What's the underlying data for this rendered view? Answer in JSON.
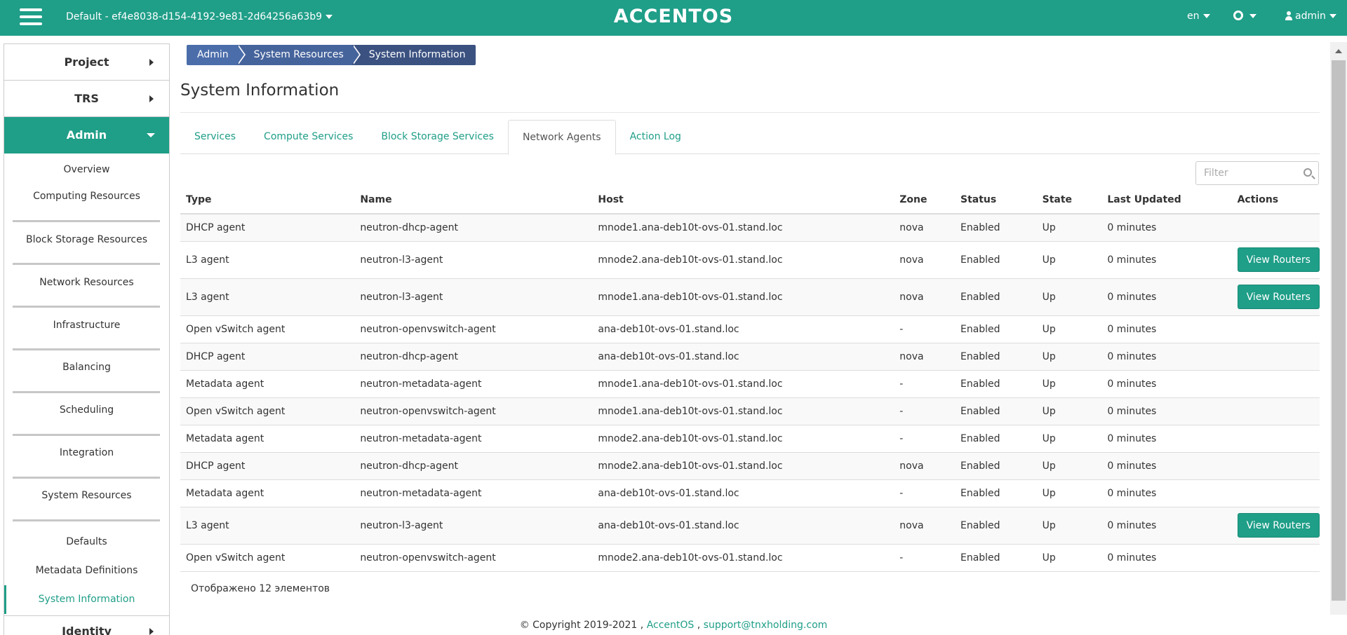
{
  "topbar": {
    "project": "Default - ef4e8038-d154-4192-9e81-2d64256a63b9",
    "logo": "ACCENTOS",
    "language": "en",
    "user": "admin"
  },
  "sidebar": {
    "project": "Project",
    "trs": "TRS",
    "admin": "Admin",
    "items": [
      "Overview",
      "Computing Resources",
      "Block Storage Resources",
      "Network Resources",
      "Infrastructure",
      "Balancing",
      "Scheduling",
      "Integration",
      "System Resources"
    ],
    "sub_items": [
      "Defaults",
      "Metadata Definitions",
      "System Information"
    ],
    "identity": "Identity"
  },
  "breadcrumb": [
    "Admin",
    "System Resources",
    "System Information"
  ],
  "page_title": "System Information",
  "tabs": [
    "Services",
    "Compute Services",
    "Block Storage Services",
    "Network Agents",
    "Action Log"
  ],
  "filter": {
    "placeholder": "Filter"
  },
  "table": {
    "headers": [
      "Type",
      "Name",
      "Host",
      "Zone",
      "Status",
      "State",
      "Last Updated",
      "Actions"
    ],
    "action_label": "View Routers",
    "rows": [
      {
        "type": "DHCP agent",
        "name": "neutron-dhcp-agent",
        "host": "mnode1.ana-deb10t-ovs-01.stand.loc",
        "zone": "nova",
        "status": "Enabled",
        "state": "Up",
        "updated": "0 minutes",
        "action": false
      },
      {
        "type": "L3 agent",
        "name": "neutron-l3-agent",
        "host": "mnode2.ana-deb10t-ovs-01.stand.loc",
        "zone": "nova",
        "status": "Enabled",
        "state": "Up",
        "updated": "0 minutes",
        "action": true
      },
      {
        "type": "L3 agent",
        "name": "neutron-l3-agent",
        "host": "mnode1.ana-deb10t-ovs-01.stand.loc",
        "zone": "nova",
        "status": "Enabled",
        "state": "Up",
        "updated": "0 minutes",
        "action": true
      },
      {
        "type": "Open vSwitch agent",
        "name": "neutron-openvswitch-agent",
        "host": "ana-deb10t-ovs-01.stand.loc",
        "zone": "-",
        "status": "Enabled",
        "state": "Up",
        "updated": "0 minutes",
        "action": false
      },
      {
        "type": "DHCP agent",
        "name": "neutron-dhcp-agent",
        "host": "ana-deb10t-ovs-01.stand.loc",
        "zone": "nova",
        "status": "Enabled",
        "state": "Up",
        "updated": "0 minutes",
        "action": false
      },
      {
        "type": "Metadata agent",
        "name": "neutron-metadata-agent",
        "host": "mnode1.ana-deb10t-ovs-01.stand.loc",
        "zone": "-",
        "status": "Enabled",
        "state": "Up",
        "updated": "0 minutes",
        "action": false
      },
      {
        "type": "Open vSwitch agent",
        "name": "neutron-openvswitch-agent",
        "host": "mnode1.ana-deb10t-ovs-01.stand.loc",
        "zone": "-",
        "status": "Enabled",
        "state": "Up",
        "updated": "0 minutes",
        "action": false
      },
      {
        "type": "Metadata agent",
        "name": "neutron-metadata-agent",
        "host": "mnode2.ana-deb10t-ovs-01.stand.loc",
        "zone": "-",
        "status": "Enabled",
        "state": "Up",
        "updated": "0 minutes",
        "action": false
      },
      {
        "type": "DHCP agent",
        "name": "neutron-dhcp-agent",
        "host": "mnode2.ana-deb10t-ovs-01.stand.loc",
        "zone": "nova",
        "status": "Enabled",
        "state": "Up",
        "updated": "0 minutes",
        "action": false
      },
      {
        "type": "Metadata agent",
        "name": "neutron-metadata-agent",
        "host": "ana-deb10t-ovs-01.stand.loc",
        "zone": "-",
        "status": "Enabled",
        "state": "Up",
        "updated": "0 minutes",
        "action": false
      },
      {
        "type": "L3 agent",
        "name": "neutron-l3-agent",
        "host": "ana-deb10t-ovs-01.stand.loc",
        "zone": "nova",
        "status": "Enabled",
        "state": "Up",
        "updated": "0 minutes",
        "action": true
      },
      {
        "type": "Open vSwitch agent",
        "name": "neutron-openvswitch-agent",
        "host": "mnode2.ana-deb10t-ovs-01.stand.loc",
        "zone": "-",
        "status": "Enabled",
        "state": "Up",
        "updated": "0 minutes",
        "action": false
      }
    ],
    "count_text": "Отображено 12 элементов"
  },
  "footer": {
    "copyright": "© Copyright 2019-2021 ,",
    "brand_link": "AccentOS",
    "separator": ",",
    "email_link": "support@tnxholding.com"
  },
  "colors": {
    "accent": "#1f9e88",
    "breadcrumb_1": "#4b6eab",
    "breadcrumb_2": "#46649c",
    "breadcrumb_3": "#3b5281"
  },
  "icons": {
    "menu": "hamburger-menu-icon",
    "settings": "gear-icon",
    "user": "user-icon",
    "search": "search-icon"
  }
}
